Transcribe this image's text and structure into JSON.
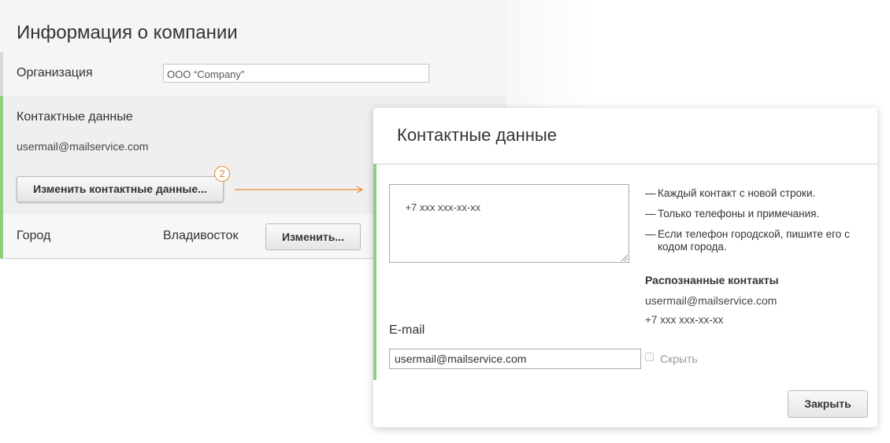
{
  "page": {
    "title": "Информация о компании",
    "organization": {
      "label": "Организация",
      "value": "ООО “Company”"
    },
    "contacts": {
      "label": "Контактные данные",
      "email": "usermail@mailservice.com",
      "edit_button": "Изменить контактные данные...",
      "step_number": "2"
    },
    "city": {
      "label": "Город",
      "value": "Владивосток",
      "edit_button": "Изменить..."
    }
  },
  "modal": {
    "title": "Контактные данные",
    "phones_value": "+7 xxx xxx-xx-xx",
    "hints": [
      "Каждый контакт с новой строки.",
      "Только телефоны и примечания.",
      "Если телефон городской, пишите его с кодом города."
    ],
    "hint_dash": "—",
    "recognized": {
      "title": "Распознанные контакты",
      "items": [
        "usermail@mailservice.com",
        "+7 xxx xxx-xx-xx"
      ]
    },
    "email": {
      "label": "E-mail",
      "value": "usermail@mailservice.com"
    },
    "hide_checkbox": {
      "label": "Скрыть",
      "checked": false
    },
    "close_button": "Закрыть"
  },
  "colors": {
    "accent_green": "#8fcf7a",
    "step_orange": "#e88a2e"
  }
}
